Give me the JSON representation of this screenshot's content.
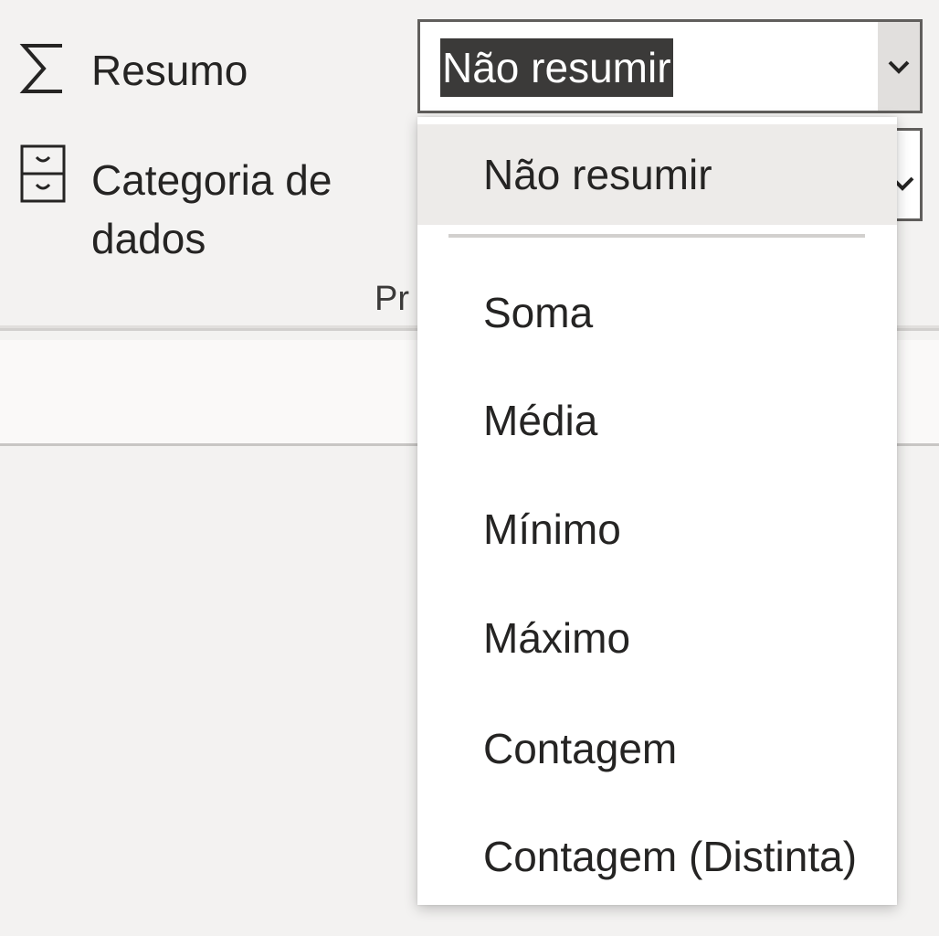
{
  "fields": {
    "summarization": {
      "label": "Resumo",
      "icon": "sigma-icon",
      "value": "Não resumir"
    },
    "data_category": {
      "label_line1": "Categoria de",
      "label_line2": "dados",
      "icon": "drawer-icon"
    }
  },
  "section": {
    "label": "Pr"
  },
  "dropdown": {
    "selected": "Não resumir",
    "options": [
      "Não resumir",
      "Soma",
      "Média",
      "Mínimo",
      "Máximo",
      "Contagem",
      "Contagem (Distinta)"
    ]
  },
  "colors": {
    "selection_highlight": "#3b3a39",
    "hover_item": "#edebe9",
    "background": "#f3f2f1"
  }
}
